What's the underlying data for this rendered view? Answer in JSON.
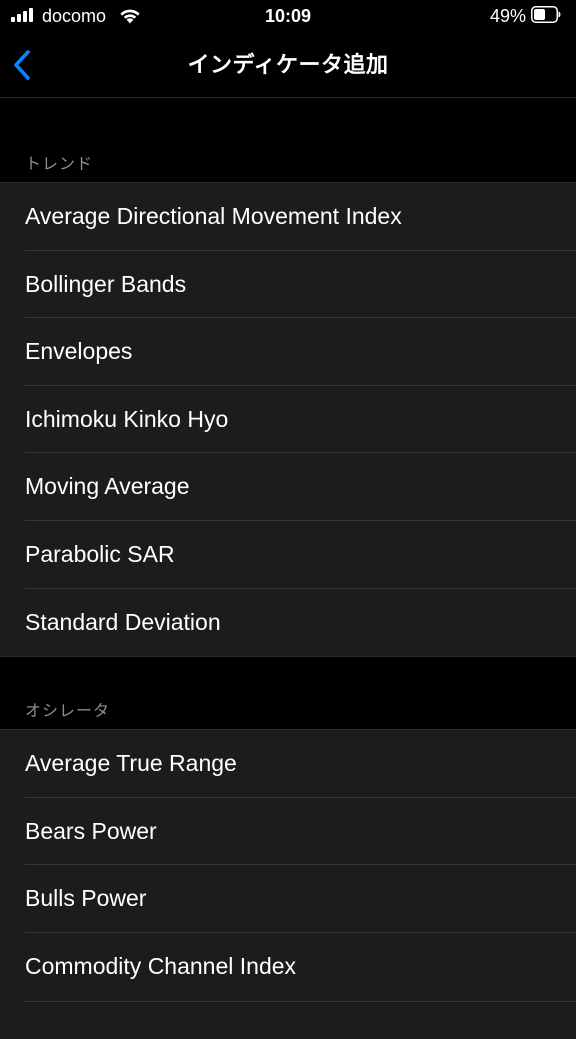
{
  "status_bar": {
    "carrier": "docomo",
    "time": "10:09",
    "battery_percent": "49%"
  },
  "nav": {
    "title": "インディケータ追加",
    "back_icon": "chevron-left-icon",
    "accent_color": "#0a84ff"
  },
  "sections": [
    {
      "header": "トレンド",
      "items": [
        "Average Directional Movement Index",
        "Bollinger Bands",
        "Envelopes",
        "Ichimoku Kinko Hyo",
        "Moving Average",
        "Parabolic SAR",
        "Standard Deviation"
      ]
    },
    {
      "header": "オシレータ",
      "items": [
        "Average True Range",
        "Bears Power",
        "Bulls Power",
        "Commodity Channel Index"
      ]
    }
  ]
}
